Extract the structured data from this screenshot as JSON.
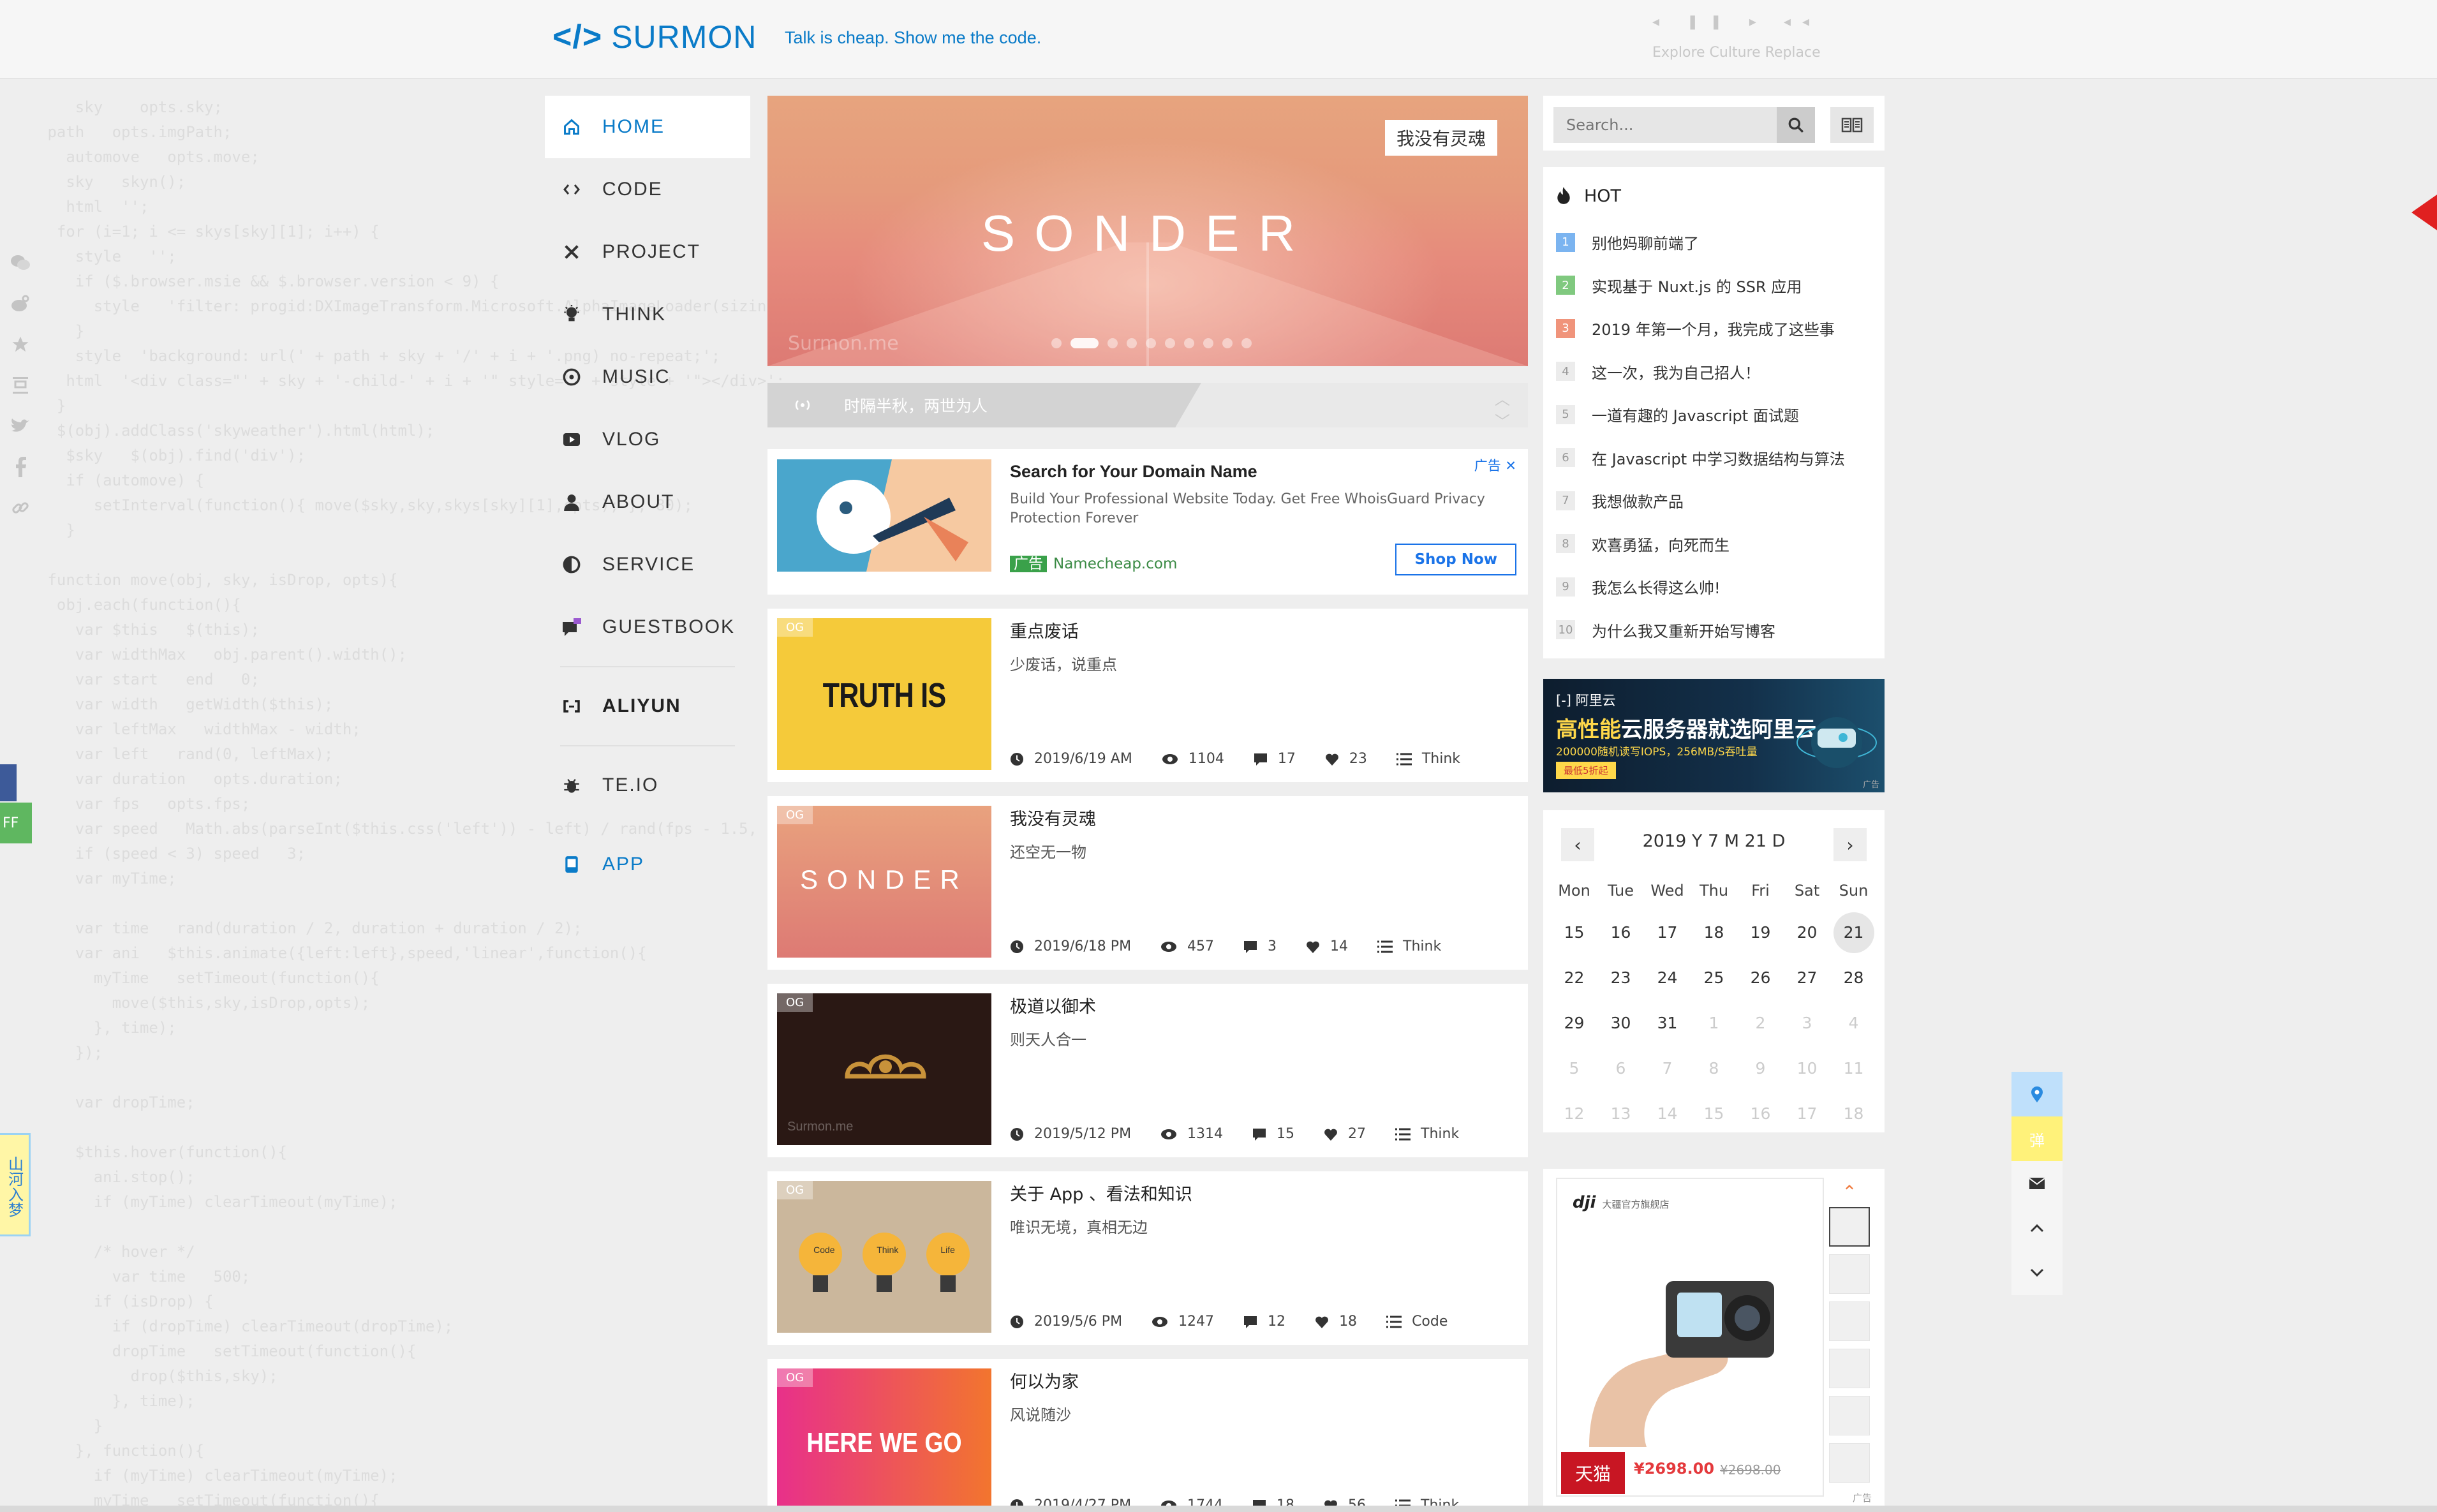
{
  "header": {
    "logo_text": "SURMON",
    "slogan": "Talk is cheap. Show me the code.",
    "player_hint": "Explore Culture Replace"
  },
  "nav": {
    "items": [
      {
        "label": "HOME",
        "icon": "home-icon"
      },
      {
        "label": "CODE",
        "icon": "code-icon"
      },
      {
        "label": "PROJECT",
        "icon": "tools-icon"
      },
      {
        "label": "THINK",
        "icon": "bulb-icon"
      },
      {
        "label": "MUSIC",
        "icon": "music-icon"
      },
      {
        "label": "VLOG",
        "icon": "video-icon"
      },
      {
        "label": "ABOUT",
        "icon": "user-icon"
      },
      {
        "label": "SERVICE",
        "icon": "service-icon"
      },
      {
        "label": "GUESTBOOK",
        "icon": "comment-icon"
      }
    ],
    "extra": [
      {
        "label": "ALIYUN",
        "icon": "aliyun-icon"
      },
      {
        "label": "TE.IO",
        "icon": "bug-icon"
      },
      {
        "label": "APP",
        "icon": "phone-icon"
      }
    ]
  },
  "banner": {
    "title": "SONDER",
    "badge": "我没有灵魂",
    "watermark": "Surmon.me",
    "slides": 10,
    "active_slide": 2
  },
  "announcement": {
    "text": "时隔半秋，两世为人"
  },
  "ad": {
    "title": "Search for Your Domain Name",
    "description": "Build Your Professional Website Today. Get Free WhoisGuard Privacy Protection Forever",
    "label": "广告",
    "site": "Namecheap.com",
    "cta": "Shop Now",
    "corner": "广告"
  },
  "posts": [
    {
      "title": "重点废话",
      "desc": "少废话，说重点",
      "date": "2019/6/19 AM",
      "views": "1104",
      "comments": "17",
      "likes": "23",
      "category": "Think",
      "tag": "OG",
      "thumb_text": "TRUTH IS"
    },
    {
      "title": "我没有灵魂",
      "desc": "还空无一物",
      "date": "2019/6/18 PM",
      "views": "457",
      "comments": "3",
      "likes": "14",
      "category": "Think",
      "tag": "OG",
      "thumb_text": "SONDER"
    },
    {
      "title": "极道以御术",
      "desc": "则天人合一",
      "date": "2019/5/12 PM",
      "views": "1314",
      "comments": "15",
      "likes": "27",
      "category": "Think",
      "tag": "OG",
      "thumb_text": "Surmon.me"
    },
    {
      "title": "关于 App 、看法和知识",
      "desc": "唯识无境，真相无边",
      "date": "2019/5/6 PM",
      "views": "1247",
      "comments": "12",
      "likes": "18",
      "category": "Code",
      "tag": "OG",
      "thumb_text": "Code Think Life"
    },
    {
      "title": "何以为家",
      "desc": "风说随沙",
      "date": "2019/4/27 PM",
      "views": "1744",
      "comments": "18",
      "likes": "56",
      "category": "Think",
      "tag": "OG",
      "thumb_text": "HERE WE GO"
    }
  ],
  "search": {
    "placeholder": "Search..."
  },
  "hot": {
    "title": "HOT",
    "items": [
      {
        "n": "1",
        "text": "别他妈聊前端了",
        "color": "#7bb4f0"
      },
      {
        "n": "2",
        "text": "实现基于 Nuxt.js 的 SSR 应用",
        "color": "#80c97f"
      },
      {
        "n": "3",
        "text": "2019 年第一个月，我完成了这些事",
        "color": "#f0947b"
      },
      {
        "n": "4",
        "text": "这一次，我为自己招人！",
        "color": ""
      },
      {
        "n": "5",
        "text": "一道有趣的 Javascript 面试题",
        "color": ""
      },
      {
        "n": "6",
        "text": "在 Javascript 中学习数据结构与算法",
        "color": ""
      },
      {
        "n": "7",
        "text": "我想做款产品",
        "color": ""
      },
      {
        "n": "8",
        "text": "欢喜勇猛，向死而生",
        "color": ""
      },
      {
        "n": "9",
        "text": "我怎么长得这么帅!",
        "color": ""
      },
      {
        "n": "10",
        "text": "为什么我又重新开始写博客",
        "color": ""
      }
    ]
  },
  "aliyun_ad": {
    "brand": "阿里云",
    "headline_a": "高性能",
    "headline_b": "云服务器就选阿里云",
    "sub": "200000随机读写IOPS，256MB/S吞吐量",
    "tag": "最低5折起",
    "corner": "广告"
  },
  "calendar": {
    "title": "2019 Y 7 M 21 D",
    "weekdays": [
      "Mon",
      "Tue",
      "Wed",
      "Thu",
      "Fri",
      "Sat",
      "Sun"
    ],
    "days": [
      {
        "d": "15"
      },
      {
        "d": "16"
      },
      {
        "d": "17"
      },
      {
        "d": "18"
      },
      {
        "d": "19"
      },
      {
        "d": "20"
      },
      {
        "d": "21",
        "today": true
      },
      {
        "d": "22"
      },
      {
        "d": "23"
      },
      {
        "d": "24"
      },
      {
        "d": "25"
      },
      {
        "d": "26"
      },
      {
        "d": "27"
      },
      {
        "d": "28"
      },
      {
        "d": "29"
      },
      {
        "d": "30"
      },
      {
        "d": "31"
      },
      {
        "d": "1",
        "dim": true
      },
      {
        "d": "2",
        "dim": true
      },
      {
        "d": "3",
        "dim": true
      },
      {
        "d": "4",
        "dim": true
      },
      {
        "d": "5",
        "dim": true
      },
      {
        "d": "6",
        "dim": true
      },
      {
        "d": "7",
        "dim": true
      },
      {
        "d": "8",
        "dim": true
      },
      {
        "d": "9",
        "dim": true
      },
      {
        "d": "10",
        "dim": true
      },
      {
        "d": "11",
        "dim": true
      },
      {
        "d": "12",
        "dim": true
      },
      {
        "d": "13",
        "dim": true
      },
      {
        "d": "14",
        "dim": true
      },
      {
        "d": "15",
        "dim": true
      },
      {
        "d": "16",
        "dim": true
      },
      {
        "d": "17",
        "dim": true
      },
      {
        "d": "18",
        "dim": true
      }
    ]
  },
  "product_ad": {
    "brand": "dji",
    "store": "大疆官方旗舰店",
    "price": "¥2698.00",
    "old_price": "¥2698.00",
    "badge": "天猫",
    "corner": "广告"
  },
  "tools": {
    "barrage": "弹"
  },
  "left_tags": {
    "yellow": "山河入梦",
    "green": "FF"
  }
}
